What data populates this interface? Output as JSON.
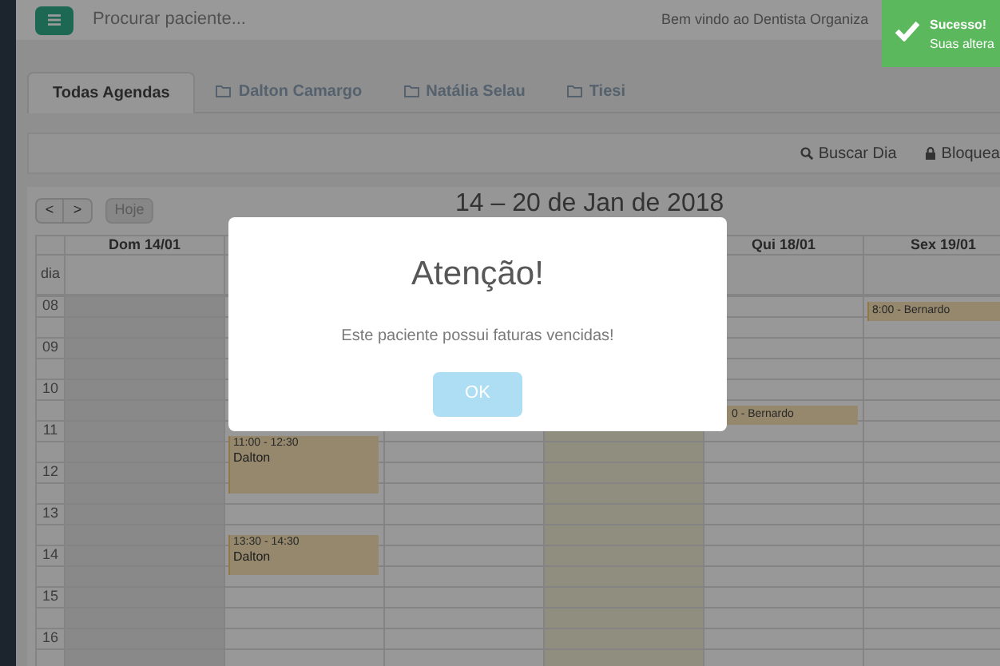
{
  "header": {
    "search_placeholder": "Procurar paciente...",
    "welcome": "Bem vindo ao Dentista Organiza"
  },
  "toast": {
    "title": "Sucesso!",
    "message": "Suas altera"
  },
  "tabs": [
    {
      "label": "Todas Agendas",
      "selected": true
    },
    {
      "label": "Dalton Camargo",
      "selected": false
    },
    {
      "label": "Natália Selau",
      "selected": false
    },
    {
      "label": "Tiesi",
      "selected": false
    }
  ],
  "toolbar": {
    "buttons": [
      "Buscar Dia",
      "Bloquea"
    ]
  },
  "calendar": {
    "nav": {
      "prev": "<",
      "next": ">",
      "today": "Hoje",
      "today_disabled": true
    },
    "title": "14 – 20 de Jan de 2018",
    "allday_label": "dia",
    "hours": [
      "08",
      "09",
      "10",
      "11",
      "12",
      "13",
      "14",
      "15",
      "16"
    ],
    "columns": [
      {
        "label": "Dom 14/01",
        "today": false,
        "closed": true
      },
      {
        "today": false,
        "closed": false,
        "events": [
          {
            "kind": "block",
            "time": "11:00 - 12:30",
            "patient": "Dalton"
          },
          {
            "kind": "block",
            "time": "13:30 - 14:30",
            "patient": "Dalton"
          }
        ]
      },
      {
        "today": false,
        "closed": false
      },
      {
        "today": true,
        "closed": false
      },
      {
        "label": "Qui 18/01",
        "today": false,
        "closed": false,
        "events": [
          {
            "kind": "line",
            "text": "0 - Bernardo"
          }
        ]
      },
      {
        "label": "Sex 19/01",
        "today": false,
        "closed": false,
        "events": [
          {
            "kind": "line",
            "text": "8:00 - Bernardo"
          }
        ]
      }
    ]
  },
  "modal": {
    "title": "Atenção!",
    "message": "Este paciente possui faturas vencidas!",
    "button": "OK"
  }
}
